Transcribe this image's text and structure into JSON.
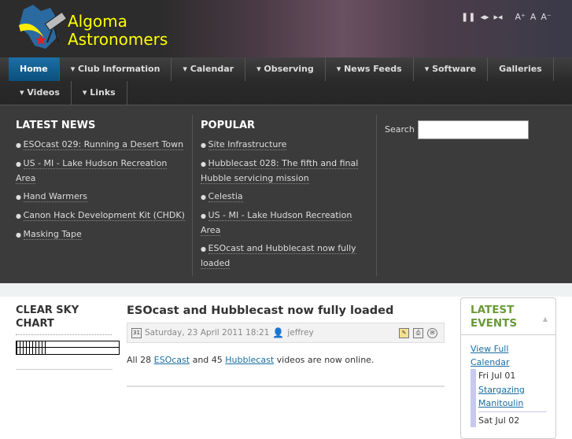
{
  "header": {
    "title_line1": "Algoma",
    "title_line2": "Astronomers",
    "logo_text": "Algoma Astronomers",
    "tools": {
      "pause": "❚❚",
      "prev_next": "◂▸",
      "shrink": "▸◂",
      "font_up": "A⁺",
      "font_reset": "A",
      "font_down": "A⁻"
    }
  },
  "nav": {
    "row1": [
      {
        "label": "Home",
        "dropdown": false
      },
      {
        "label": "Club Information",
        "dropdown": true
      },
      {
        "label": "Calendar",
        "dropdown": true
      },
      {
        "label": "Observing",
        "dropdown": true
      },
      {
        "label": "News Feeds",
        "dropdown": true
      },
      {
        "label": "Software",
        "dropdown": true
      },
      {
        "label": "Galleries",
        "dropdown": false
      }
    ],
    "row2": [
      {
        "label": "Videos",
        "dropdown": true
      },
      {
        "label": "Links",
        "dropdown": true
      }
    ]
  },
  "latest_news": {
    "title": "LATEST NEWS",
    "items": [
      "ESOcast 029: Running a Desert Town",
      "US - MI - Lake Hudson Recreation Area",
      "Hand Warmers",
      "Canon Hack Development Kit (CHDK)",
      "Masking Tape"
    ]
  },
  "popular": {
    "title": "POPULAR",
    "items": [
      "Site Infrastructure",
      "Hubblecast 028: The fifth and final Hubble servicing mission",
      "Celestia",
      "US - MI - Lake Hudson Recreation Area",
      "ESOcast and Hubblecast now fully loaded"
    ]
  },
  "search": {
    "label": "Search",
    "value": ""
  },
  "left": {
    "title": "CLEAR SKY CHART"
  },
  "article": {
    "title": "ESOcast and Hubblecast now fully loaded",
    "date": "Saturday, 23 April 2011 18:21",
    "author": "jeffrey",
    "body_pre": "All 28 ",
    "link1": "ESOcast",
    "body_mid": " and 45 ",
    "link2": "Hubblecast",
    "body_post": " videos are now online."
  },
  "events": {
    "title": "LATEST EVENTS",
    "view_full": "View Full Calendar",
    "items": [
      {
        "date": "Fri Jul 01",
        "title": "Stargazing Manitoulin"
      },
      {
        "date": "Sat Jul 02"
      }
    ]
  }
}
